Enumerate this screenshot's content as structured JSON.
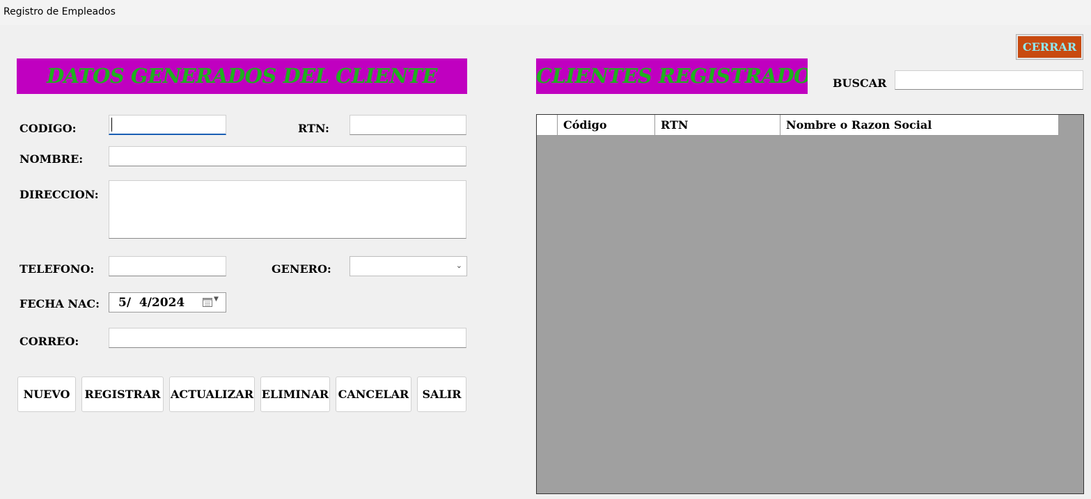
{
  "window": {
    "title": "Registro de Empleados"
  },
  "left_banner": {
    "text": "DATOS GENERADOS DEL CLIENTE"
  },
  "right_banner": {
    "text": "CLIENTES REGISTRADOS"
  },
  "close_button": {
    "label": "CERRAR"
  },
  "search": {
    "label": "BUSCAR",
    "value": ""
  },
  "form": {
    "codigo_label": "CODIGO:",
    "rtn_label": "RTN:",
    "nombre_label": "NOMBRE:",
    "direccion_label": "DIRECCION:",
    "telefono_label": "TELEFONO:",
    "genero_label": "GENERO:",
    "fecha_label": "FECHA NAC:",
    "fecha_value": "5/  4/2024",
    "correo_label": "CORREO:"
  },
  "actions": {
    "nuevo": "NUEVO",
    "registrar": "REGISTRAR",
    "actualizar": "ACTUALIZAR",
    "eliminar": "ELIMINAR",
    "cancelar": "CANCELAR",
    "salir": "SALIR"
  },
  "table": {
    "columns": [
      "Código",
      "RTN",
      "Nombre o Razon Social"
    ],
    "rows": []
  },
  "colors": {
    "banner_bg": "#c000c0",
    "banner_text": "#1fb01f",
    "close_bg": "#c84a10",
    "close_text": "#8fe8f0",
    "grid_bg": "#a0a0a0"
  },
  "icons": {
    "calendar": "calendar-icon",
    "dropdown": "chevron-down-icon"
  }
}
